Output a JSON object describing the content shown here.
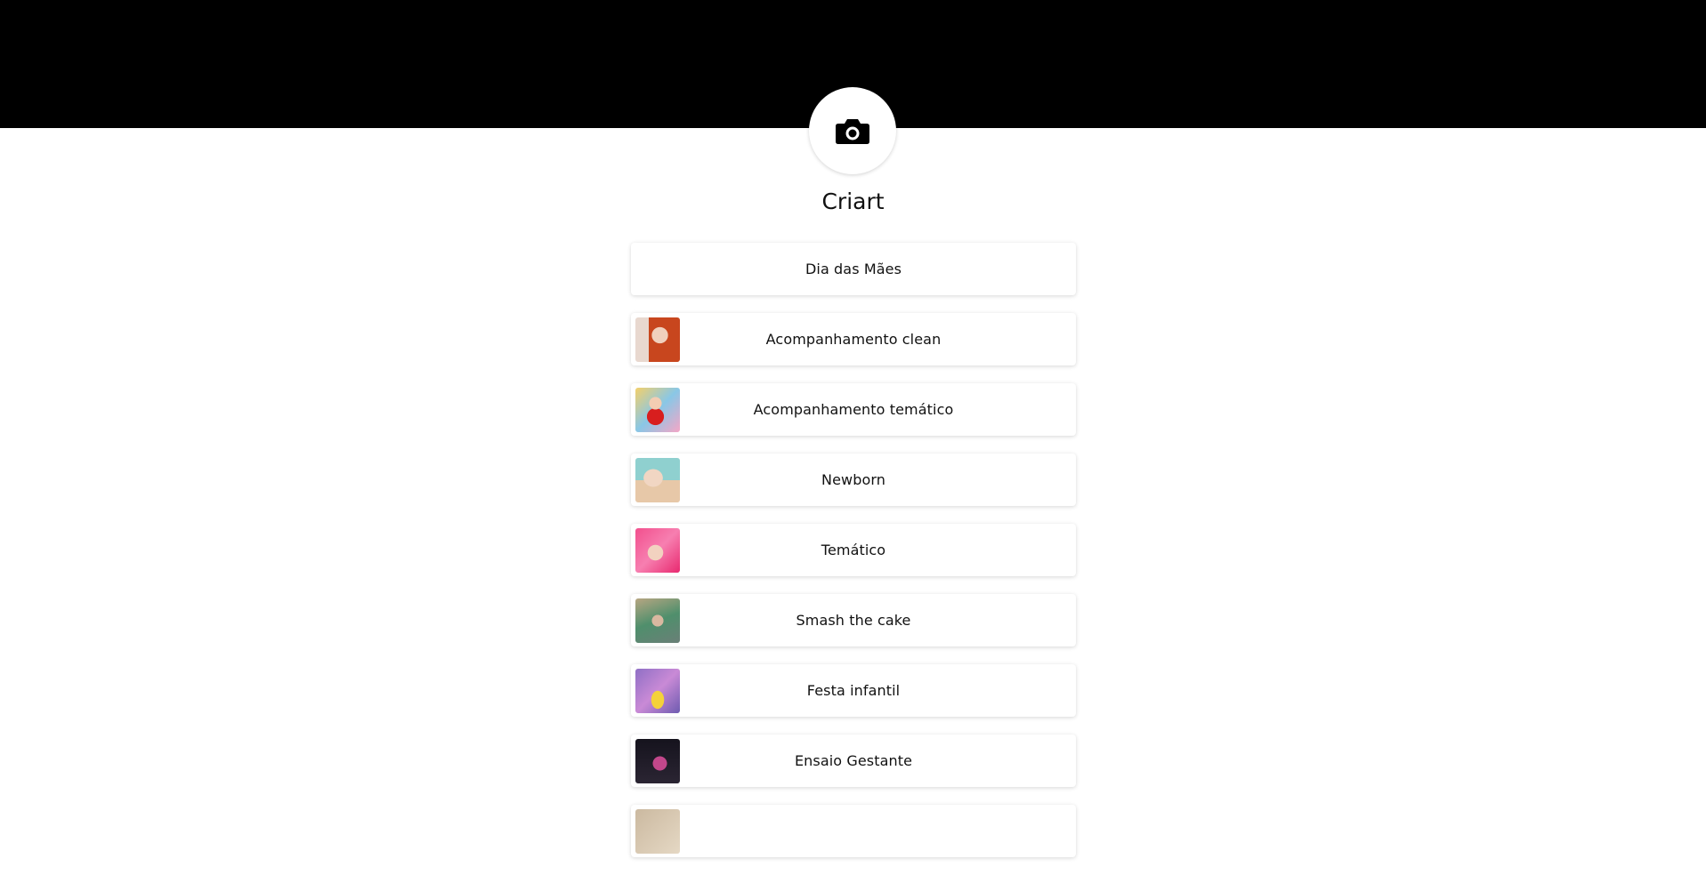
{
  "header": {
    "band_color": "#000000"
  },
  "profile": {
    "avatar_icon": "camera-icon",
    "name": "Criart"
  },
  "links": [
    {
      "label": "Dia das Mães",
      "has_thumbnail": false
    },
    {
      "label": "Acompanhamento clean",
      "has_thumbnail": true
    },
    {
      "label": "Acompanhamento temático",
      "has_thumbnail": true
    },
    {
      "label": "Newborn",
      "has_thumbnail": true
    },
    {
      "label": "Temático",
      "has_thumbnail": true
    },
    {
      "label": "Smash the cake",
      "has_thumbnail": true
    },
    {
      "label": "Festa infantil",
      "has_thumbnail": true
    },
    {
      "label": "Ensaio Gestante",
      "has_thumbnail": true
    },
    {
      "label": "",
      "has_thumbnail": true
    }
  ]
}
